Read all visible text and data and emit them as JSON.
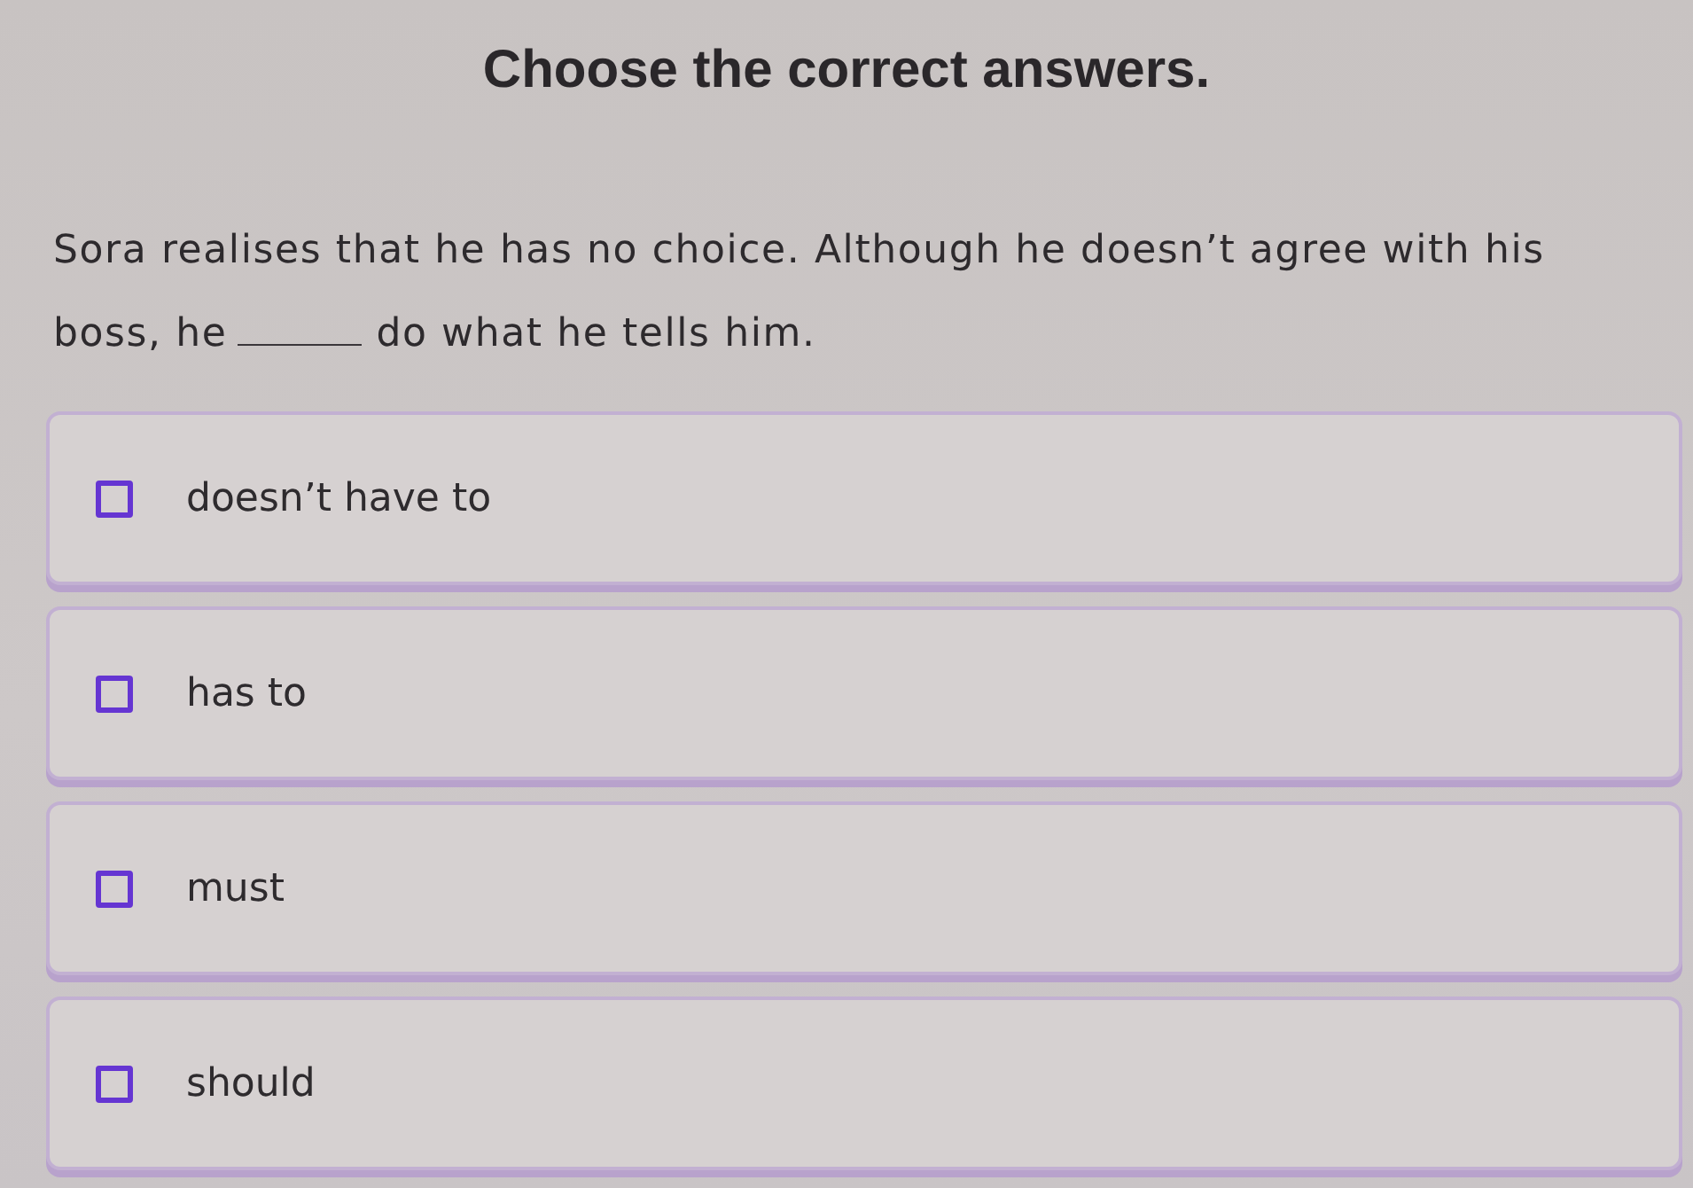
{
  "title": "Choose the correct answers.",
  "question": {
    "before": "Sora realises that he has no choice. Although he doesn’t agree with his boss, he",
    "after": "do what he tells him."
  },
  "options": [
    {
      "label": "doesn’t have to",
      "checked": false
    },
    {
      "label": "has to",
      "checked": false
    },
    {
      "label": "must",
      "checked": false
    },
    {
      "label": "should",
      "checked": false
    }
  ]
}
